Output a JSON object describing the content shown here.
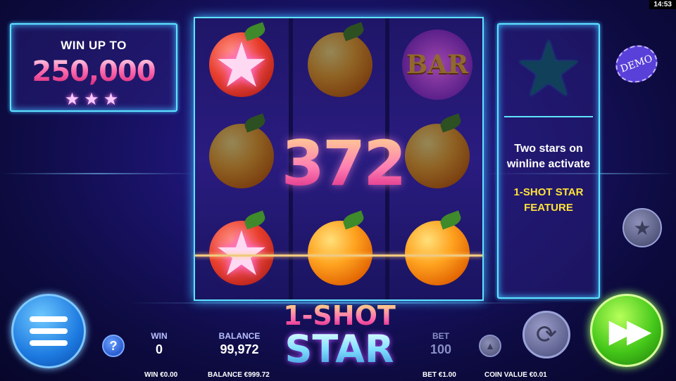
{
  "status_bar": {
    "clock": "14:53"
  },
  "win_panel": {
    "title": "WIN UP TO",
    "amount": "250,000",
    "stars": "★★★"
  },
  "reels": {
    "big_win": "372",
    "symbols": [
      [
        "star-orange",
        "orange",
        "bar"
      ],
      [
        "orange",
        "orange-hidden",
        "orange"
      ],
      [
        "star-orange",
        "orange",
        "orange"
      ]
    ],
    "bar_label": "BAR",
    "star_glyph": "★"
  },
  "feature_panel": {
    "star": "★",
    "text_line1": "Two stars on winline activate",
    "text_line2": "1-SHOT STAR FEATURE"
  },
  "demo_badge": "DEMO",
  "buttons": {
    "menu": "menu-icon",
    "help": "?",
    "star_feature": "★",
    "bet_up": "▲",
    "autoplay": "⟳",
    "spin": "▶▶"
  },
  "stats": {
    "win_label": "WIN",
    "win_value": "0",
    "balance_label": "BALANCE",
    "balance_value": "99,972",
    "bet_label": "BET",
    "bet_value": "100"
  },
  "logo": {
    "line1": "1-SHOT",
    "line2": "STAR"
  },
  "footer": {
    "win": "WIN €0.00",
    "balance": "BALANCE €999.72",
    "bet": "BET €1.00",
    "coin_value": "COIN VALUE €0.01"
  },
  "colors": {
    "accent": "#5fe3ff",
    "spin": "#45c81a",
    "menu": "#1d7ae0",
    "feature_highlight": "#ffe23a"
  }
}
